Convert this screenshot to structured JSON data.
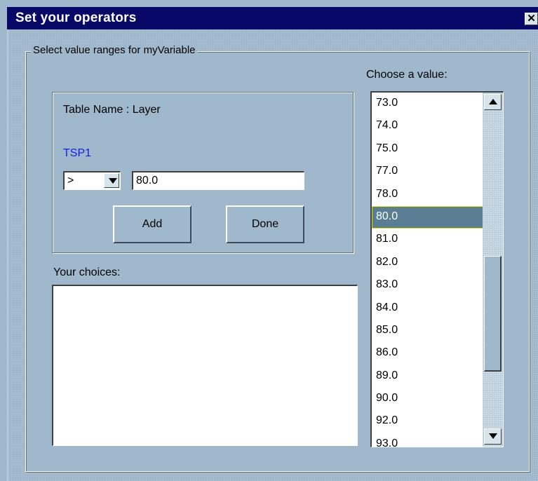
{
  "window": {
    "title": "Set your operators",
    "close_label": "✕"
  },
  "group": {
    "legend": "Select value ranges for myVariable"
  },
  "panel": {
    "table_name": "Table Name : Layer",
    "field_label": "TSP1",
    "operator_value": ">",
    "value_input": "80.0",
    "add_label": "Add",
    "done_label": "Done"
  },
  "choices": {
    "label": "Your choices:"
  },
  "value_list": {
    "label": "Choose a value:",
    "items": [
      "73.0",
      "74.0",
      "75.0",
      "77.0",
      "78.0",
      "80.0",
      "81.0",
      "82.0",
      "83.0",
      "84.0",
      "85.0",
      "86.0",
      "89.0",
      "90.0",
      "92.0",
      "93.0"
    ],
    "selected": "80.0"
  },
  "colors": {
    "title_bar": "#080868",
    "background": "#9fb8cc",
    "selection": "#5a7f94",
    "field_label": "#1a1ae6"
  },
  "icons": {
    "close": "close-icon",
    "dropdown": "chevron-down-icon",
    "scroll_up": "arrow-up-icon",
    "scroll_down": "arrow-down-icon"
  }
}
